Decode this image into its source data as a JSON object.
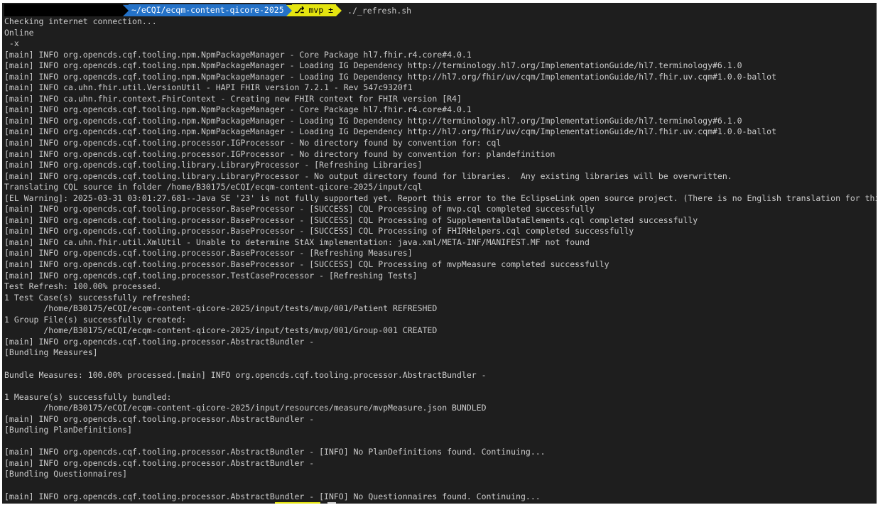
{
  "prompt": {
    "directory": "~/eCQI/ecqm-content-qicore-2025",
    "branch_icon": "⎇",
    "branch": "mvp ±",
    "command": "./_refresh.sh"
  },
  "output_lines": [
    "Checking internet connection...",
    "Online",
    " -x",
    "[main] INFO org.opencds.cqf.tooling.npm.NpmPackageManager - Core Package hl7.fhir.r4.core#4.0.1",
    "[main] INFO org.opencds.cqf.tooling.npm.NpmPackageManager - Loading IG Dependency http://terminology.hl7.org/ImplementationGuide/hl7.terminology#6.1.0",
    "[main] INFO org.opencds.cqf.tooling.npm.NpmPackageManager - Loading IG Dependency http://hl7.org/fhir/uv/cqm/ImplementationGuide/hl7.fhir.uv.cqm#1.0.0-ballot",
    "[main] INFO ca.uhn.fhir.util.VersionUtil - HAPI FHIR version 7.2.1 - Rev 547c9320f1",
    "[main] INFO ca.uhn.fhir.context.FhirContext - Creating new FHIR context for FHIR version [R4]",
    "[main] INFO org.opencds.cqf.tooling.npm.NpmPackageManager - Core Package hl7.fhir.r4.core#4.0.1",
    "[main] INFO org.opencds.cqf.tooling.npm.NpmPackageManager - Loading IG Dependency http://terminology.hl7.org/ImplementationGuide/hl7.terminology#6.1.0",
    "[main] INFO org.opencds.cqf.tooling.npm.NpmPackageManager - Loading IG Dependency http://hl7.org/fhir/uv/cqm/ImplementationGuide/hl7.fhir.uv.cqm#1.0.0-ballot",
    "[main] INFO org.opencds.cqf.tooling.processor.IGProcessor - No directory found by convention for: cql",
    "[main] INFO org.opencds.cqf.tooling.processor.IGProcessor - No directory found by convention for: plandefinition",
    "[main] INFO org.opencds.cqf.tooling.library.LibraryProcessor - [Refreshing Libraries]",
    "[main] INFO org.opencds.cqf.tooling.library.LibraryProcessor - No output directory found for libraries.  Any existing libraries will be overwritten.",
    "Translating CQL source in folder /home/B30175/eCQI/ecqm-content-qicore-2025/input/cql",
    "[EL Warning]: 2025-03-31 03:01:27.681--Java SE '23' is not fully supported yet. Report this error to the EclipseLink open source project. (There is no English translation for this message.)",
    "[main] INFO org.opencds.cqf.tooling.processor.BaseProcessor - [SUCCESS] CQL Processing of mvp.cql completed successfully",
    "[main] INFO org.opencds.cqf.tooling.processor.BaseProcessor - [SUCCESS] CQL Processing of SupplementalDataElements.cql completed successfully",
    "[main] INFO org.opencds.cqf.tooling.processor.BaseProcessor - [SUCCESS] CQL Processing of FHIRHelpers.cql completed successfully",
    "[main] INFO ca.uhn.fhir.util.XmlUtil - Unable to determine StAX implementation: java.xml/META-INF/MANIFEST.MF not found",
    "[main] INFO org.opencds.cqf.tooling.processor.BaseProcessor - [Refreshing Measures]",
    "[main] INFO org.opencds.cqf.tooling.processor.BaseProcessor - [SUCCESS] CQL Processing of mvpMeasure completed successfully",
    "[main] INFO org.opencds.cqf.tooling.processor.TestCaseProcessor - [Refreshing Tests]",
    "Test Refresh: 100.00% processed.",
    "1 Test Case(s) successfully refreshed:",
    "        /home/B30175/eCQI/ecqm-content-qicore-2025/input/tests/mvp/001/Patient REFRESHED",
    "1 Group File(s) successfully created:",
    "        /home/B30175/eCQI/ecqm-content-qicore-2025/input/tests/mvp/001/Group-001 CREATED",
    "[main] INFO org.opencds.cqf.tooling.processor.AbstractBundler -",
    "[Bundling Measures]",
    "",
    "Bundle Measures: 100.00% processed.[main] INFO org.opencds.cqf.tooling.processor.AbstractBundler -",
    "",
    "1 Measure(s) successfully bundled:",
    "        /home/B30175/eCQI/ecqm-content-qicore-2025/input/resources/measure/mvpMeasure.json BUNDLED",
    "[main] INFO org.opencds.cqf.tooling.processor.AbstractBundler -",
    "[Bundling PlanDefinitions]",
    "",
    "[main] INFO org.opencds.cqf.tooling.processor.AbstractBundler - [INFO] No PlanDefinitions found. Continuing...",
    "[main] INFO org.opencds.cqf.tooling.processor.AbstractBundler -",
    "[Bundling Questionnaires]",
    "",
    "[main] INFO org.opencds.cqf.tooling.processor.AbstractBundler - [INFO] No Questionnaires found. Continuing..."
  ],
  "colors": {
    "terminal_bg": "#1e1e1e",
    "text": "#cccccc",
    "dir_segment": "#2472c8",
    "git_segment": "#e5e510"
  }
}
